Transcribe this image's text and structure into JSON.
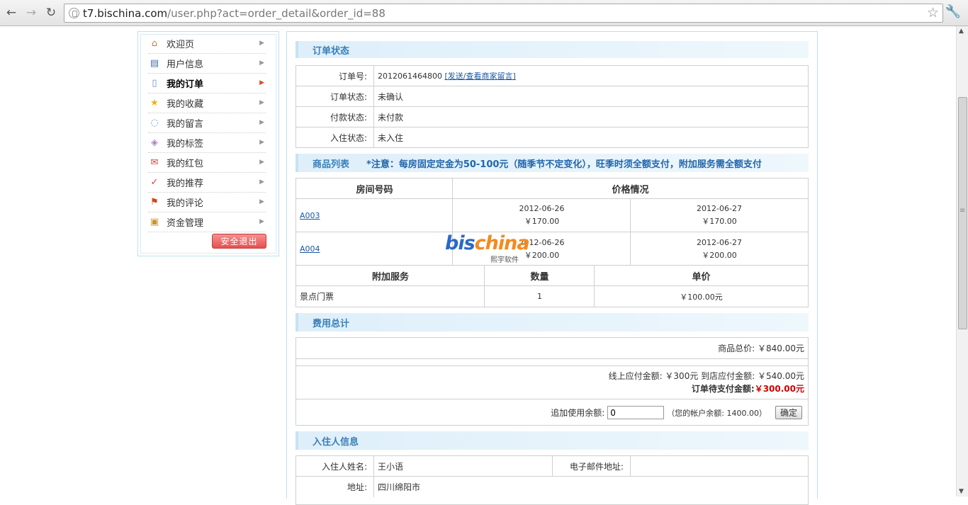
{
  "browser": {
    "url_host": "t7.bischina.com",
    "url_path": "/user.php?act=order_detail&order_id=88"
  },
  "sidebar": {
    "items": [
      {
        "label": "欢迎页",
        "icon": "house-icon",
        "active": false
      },
      {
        "label": "用户信息",
        "icon": "id-card-icon",
        "active": false
      },
      {
        "label": "我的订单",
        "icon": "document-icon",
        "active": true
      },
      {
        "label": "我的收藏",
        "icon": "star-icon",
        "active": false
      },
      {
        "label": "我的留言",
        "icon": "speech-bubble-icon",
        "active": false
      },
      {
        "label": "我的标签",
        "icon": "tag-icon",
        "active": false
      },
      {
        "label": "我的红包",
        "icon": "red-packet-icon",
        "active": false
      },
      {
        "label": "我的推荐",
        "icon": "recommend-icon",
        "active": false
      },
      {
        "label": "我的评论",
        "icon": "flag-icon",
        "active": false
      },
      {
        "label": "资金管理",
        "icon": "wallet-icon",
        "active": false
      }
    ],
    "logout_label": "安全退出"
  },
  "order_status": {
    "title": "订单状态",
    "order_no_label": "订单号:",
    "order_no": "2012061464800",
    "message_link": "[发送/查看商家留言]",
    "status_label": "订单状态:",
    "status": "未确认",
    "payment_label": "付款状态:",
    "payment": "未付款",
    "checkin_label": "入住状态:",
    "checkin": "未入住"
  },
  "goods": {
    "title": "商品列表",
    "note": "*注意：每房固定定金为50-100元（随季节不定变化），旺季时须全额支付，附加服务需全额支付",
    "col_room": "房间号码",
    "col_price": "价格情况",
    "rooms": [
      {
        "room": "A003",
        "prices": [
          {
            "date": "2012-06-26",
            "price": "￥170.00"
          },
          {
            "date": "2012-06-27",
            "price": "￥170.00"
          }
        ]
      },
      {
        "room": "A004",
        "prices": [
          {
            "date": "2012-06-26",
            "price": "￥200.00"
          },
          {
            "date": "2012-06-27",
            "price": "￥200.00"
          }
        ]
      }
    ],
    "col_service": "附加服务",
    "col_qty": "数量",
    "col_unit": "单价",
    "services": [
      {
        "name": "景点门票",
        "qty": "1",
        "unit": "￥100.00元"
      }
    ]
  },
  "watermark": {
    "brand_a": "bis",
    "brand_b": "china",
    "sub": "熙宇软件"
  },
  "fees": {
    "title": "费用总计",
    "goods_total": "商品总价: ￥840.00元",
    "online_pay": "线上应付金额: ￥300元 到店应付金额: ￥540.00元",
    "pending_label": "订单待支付金额:",
    "pending_value": "￥300.00元",
    "balance_label": "追加使用余额:",
    "balance_value": "0",
    "account_note": "（您的帐户余额: 1400.00）",
    "confirm_label": "确定"
  },
  "guest": {
    "title": "入住人信息",
    "name_label": "入住人姓名:",
    "name": "王小语",
    "email_label": "电子邮件地址:",
    "email": "",
    "address_label": "地址:",
    "address": "四川绵阳市"
  }
}
